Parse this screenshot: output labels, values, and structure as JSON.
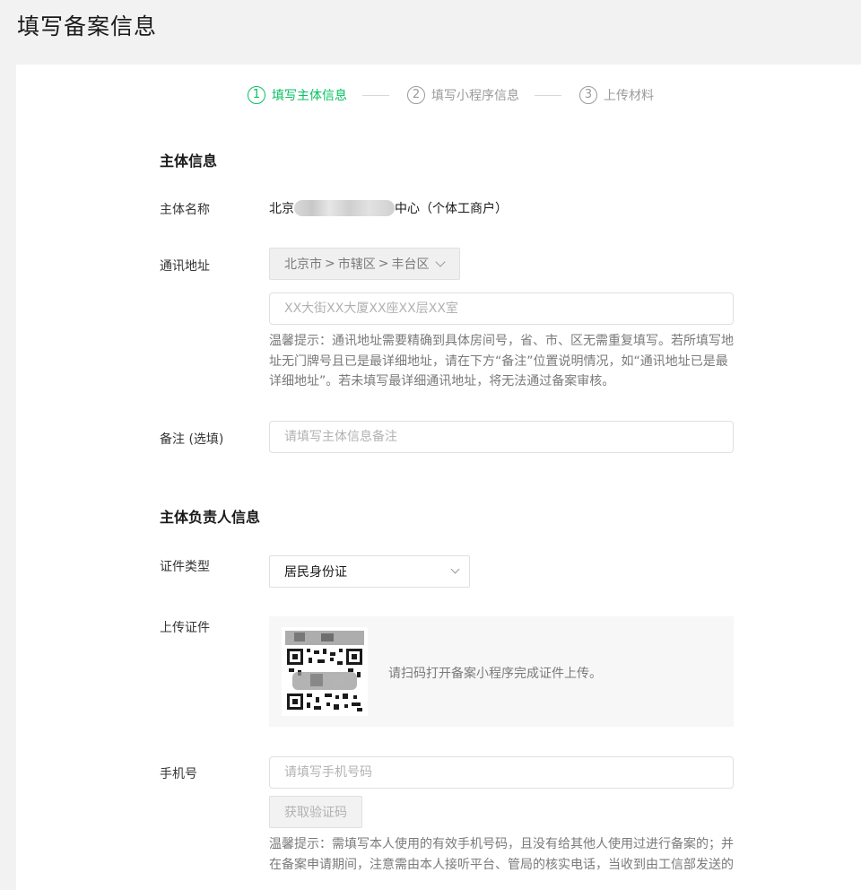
{
  "page": {
    "title": "填写备案信息"
  },
  "steps": [
    {
      "num": "1",
      "label": "填写主体信息"
    },
    {
      "num": "2",
      "label": "填写小程序信息"
    },
    {
      "num": "3",
      "label": "上传材料"
    }
  ],
  "subject": {
    "section_title": "主体信息",
    "name_label": "主体名称",
    "name_prefix": "北京",
    "name_suffix": "中心（个体工商户）",
    "address_label": "通讯地址",
    "region": {
      "province": "北京市",
      "city": "市辖区",
      "district": "丰台区",
      "sep": ">"
    },
    "address_placeholder": "XX大街XX大厦XX座XX层XX室",
    "address_hint": "温馨提示：通讯地址需要精确到具体房间号，省、市、区无需重复填写。若所填写地址无门牌号且已是最详细地址，请在下方“备注”位置说明情况，如“通讯地址已是最详细地址”。若未填写最详细通讯地址，将无法通过备案审核。",
    "remark_label": "备注 (选填)",
    "remark_placeholder": "请填写主体信息备注"
  },
  "principal": {
    "section_title": "主体负责人信息",
    "id_type_label": "证件类型",
    "id_type_value": "居民身份证",
    "upload_label": "上传证件",
    "upload_tip": "请扫码打开备案小程序完成证件上传。",
    "phone_label": "手机号",
    "phone_placeholder": "请填写手机号码",
    "get_code_label": "获取验证码",
    "phone_hint": "温馨提示：需填写本人使用的有效手机号码，且没有给其他人使用过进行备案的；并在备案申请期间，注意需由本人接听平台、管局的核实电话，当收到由工信部发送的"
  },
  "colors": {
    "accent": "#07c160",
    "background": "#f2f2f2",
    "card": "#ffffff"
  }
}
